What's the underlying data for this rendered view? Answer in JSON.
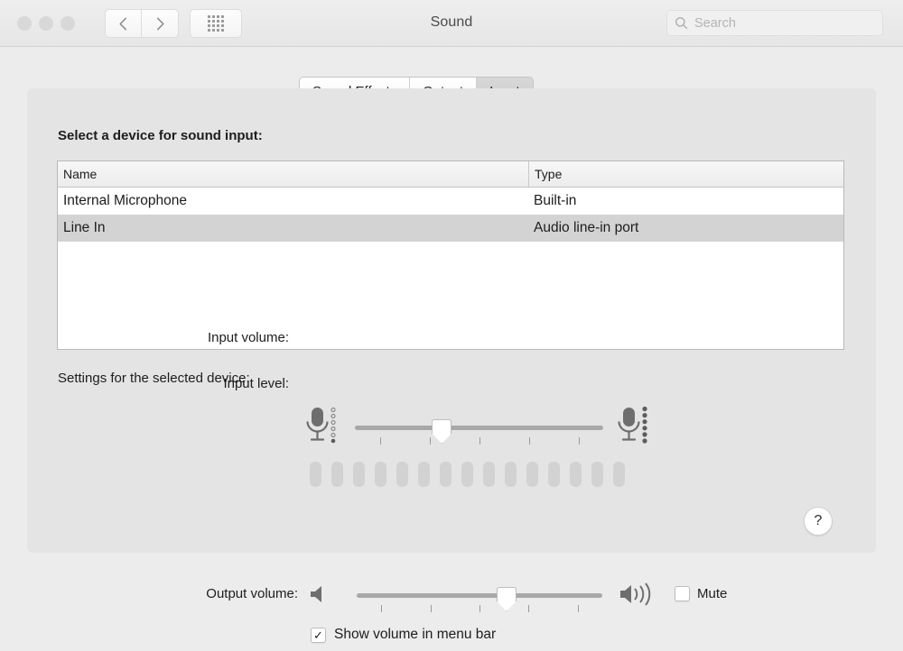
{
  "window": {
    "title": "Sound",
    "traffic_lights": [
      "close",
      "minimize",
      "zoom"
    ],
    "nav": {
      "back": "‹",
      "forward": "›",
      "show_all": "grid-icon"
    },
    "search": {
      "placeholder": "Search",
      "value": ""
    }
  },
  "tabs": [
    {
      "label": "Sound Effects",
      "active": false
    },
    {
      "label": "Output",
      "active": false
    },
    {
      "label": "Input",
      "active": true
    }
  ],
  "main": {
    "section_title": "Select a device for sound input:",
    "table": {
      "columns": [
        "Name",
        "Type"
      ],
      "rows": [
        {
          "name": "Internal Microphone",
          "type": "Built-in",
          "selected": false
        },
        {
          "name": "Line In",
          "type": "Audio line-in port",
          "selected": true
        }
      ]
    },
    "settings_label": "Settings for the selected device:",
    "input_volume": {
      "label": "Input volume:",
      "value_percent": 35,
      "tick_count": 5,
      "icon_low": "microphone-quiet-icon",
      "icon_high": "microphone-loud-icon"
    },
    "input_level": {
      "label": "Input level:",
      "segment_count": 15,
      "lit_count": 0
    },
    "help_label": "?"
  },
  "bottom": {
    "output_volume": {
      "label": "Output volume:",
      "value_percent": 61,
      "tick_count": 5,
      "icon_low": "speaker-quiet-icon",
      "icon_high": "speaker-loud-icon"
    },
    "mute": {
      "label": "Mute",
      "checked": false
    },
    "show_in_menubar": {
      "label": "Show volume in menu bar",
      "checked": true,
      "glyph": "✓"
    }
  },
  "colors": {
    "window_bg": "#ececec",
    "panel_bg": "#e4e4e4",
    "table_bg": "#ffffff",
    "row_selected": "#d3d3d3",
    "track": "#a8a8a8",
    "meter_segment": "#d2d2d2",
    "icon_gray": "#6e6e6e"
  }
}
